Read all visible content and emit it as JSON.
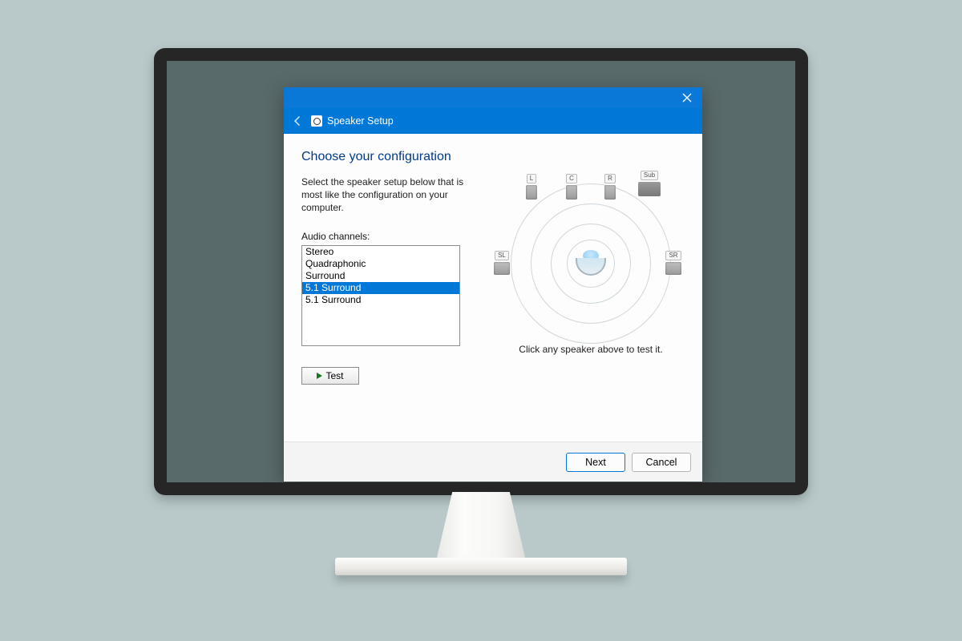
{
  "window": {
    "title": "Speaker Setup"
  },
  "heading": "Choose your configuration",
  "description": "Select the speaker setup below that is most like the configuration on your computer.",
  "audio_channels": {
    "label": "Audio channels:",
    "options": [
      "Stereo",
      "Quadraphonic",
      "Surround",
      "5.1 Surround",
      "5.1 Surround"
    ],
    "selected_index": 3
  },
  "test_button": "Test",
  "diagram": {
    "speakers": {
      "front_left": "L",
      "center": "C",
      "front_right": "R",
      "sub": "Sub",
      "side_left": "SL",
      "side_right": "SR"
    },
    "hint": "Click any speaker above to test it."
  },
  "buttons": {
    "next": "Next",
    "cancel": "Cancel"
  }
}
